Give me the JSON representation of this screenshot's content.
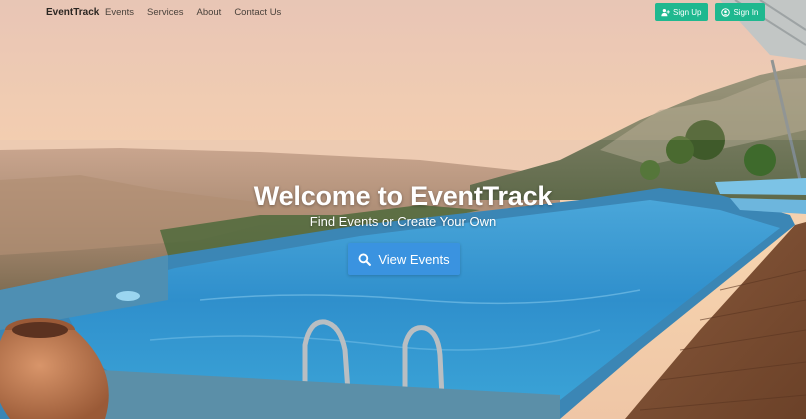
{
  "navbar": {
    "brand": "EventTrack",
    "links": [
      "Events",
      "Services",
      "About",
      "Contact Us"
    ],
    "signup_label": "Sign Up",
    "signin_label": "Sign In"
  },
  "hero": {
    "title": "Welcome to EventTrack",
    "subtitle": "Find Events or Create Your Own",
    "cta_label": "View Events"
  },
  "icons": {
    "signup": "user-plus-icon",
    "signin": "sign-in-icon",
    "cta": "search-icon"
  },
  "colors": {
    "nav_button": "#1fb88f",
    "cta_button": "#3a93e0"
  }
}
